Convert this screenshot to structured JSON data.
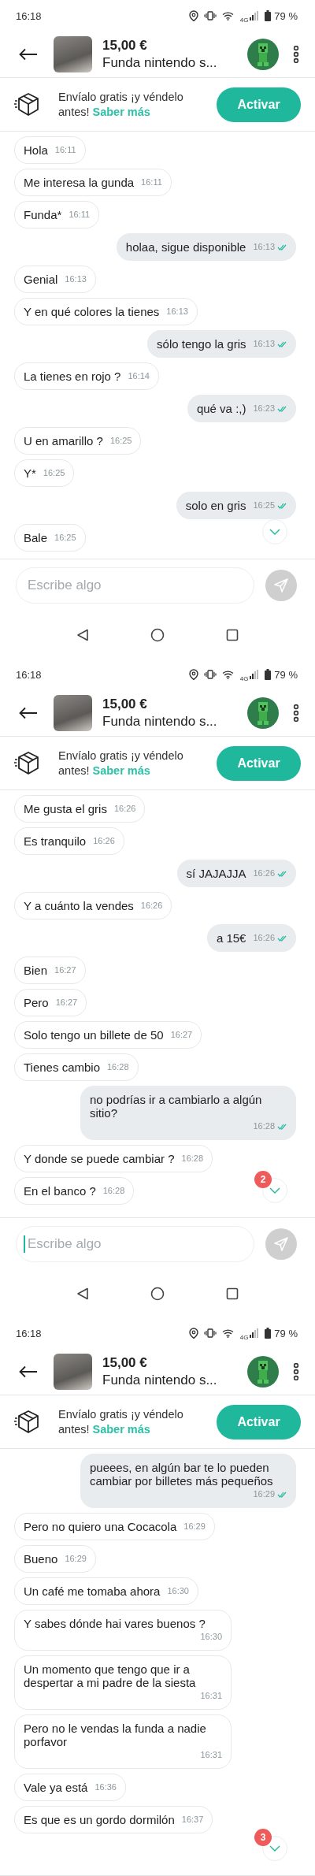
{
  "screens": [
    {
      "status_bar": {
        "time": "16:18",
        "network": "4G",
        "battery": "79 %"
      },
      "header": {
        "price": "15,00 €",
        "title": "Funda nintendo s..."
      },
      "banner": {
        "text": "Envíalo gratis ¡y véndelo antes!",
        "link": "Saber más",
        "button": "Activar"
      },
      "messages": [
        {
          "kind": "received",
          "text": "Hola",
          "time": "16:11"
        },
        {
          "kind": "received",
          "text": "Me interesa la gunda",
          "time": "16:11"
        },
        {
          "kind": "received",
          "text": "Funda*",
          "time": "16:11"
        },
        {
          "kind": "sent",
          "text": "holaa, sigue disponible",
          "time": "16:13",
          "read": true
        },
        {
          "kind": "received",
          "text": "Genial",
          "time": "16:13"
        },
        {
          "kind": "received",
          "text": "Y en qué colores la tienes",
          "time": "16:13"
        },
        {
          "kind": "sent",
          "text": "sólo tengo la gris",
          "time": "16:13",
          "read": true
        },
        {
          "kind": "received",
          "text": "La tienes en rojo ?",
          "time": "16:14"
        },
        {
          "kind": "sent",
          "text": "qué va :,)",
          "time": "16:23",
          "read": true
        },
        {
          "kind": "received",
          "text": "U en amarillo ?",
          "time": "16:25"
        },
        {
          "kind": "received",
          "text": "Y*",
          "time": "16:25"
        },
        {
          "kind": "sent",
          "text": "solo en gris",
          "time": "16:25",
          "read": true
        },
        {
          "kind": "received",
          "text": "Bale",
          "time": "16:25"
        }
      ],
      "scroll_button": true,
      "composer": {
        "placeholder": "Escribe algo",
        "focused": false
      },
      "nav_bar": true
    },
    {
      "status_bar": {
        "time": "16:18",
        "network": "4G",
        "battery": "79 %"
      },
      "header": {
        "price": "15,00 €",
        "title": "Funda nintendo s..."
      },
      "banner": {
        "text": "Envíalo gratis ¡y véndelo antes!",
        "link": "Saber más",
        "button": "Activar"
      },
      "messages": [
        {
          "kind": "received",
          "text": "Me gusta el gris",
          "time": "16:26"
        },
        {
          "kind": "received",
          "text": "Es tranquilo",
          "time": "16:26"
        },
        {
          "kind": "sent",
          "text": "sí JAJAJJA",
          "time": "16:26",
          "read": true
        },
        {
          "kind": "received",
          "text": "Y a cuánto la vendes",
          "time": "16:26"
        },
        {
          "kind": "sent",
          "text": "a 15€",
          "time": "16:26",
          "read": true
        },
        {
          "kind": "received",
          "text": "Bien",
          "time": "16:27"
        },
        {
          "kind": "received",
          "text": "Pero",
          "time": "16:27"
        },
        {
          "kind": "received",
          "text": "Solo tengo un billete de 50",
          "time": "16:27"
        },
        {
          "kind": "received",
          "text": "Tienes cambio",
          "time": "16:28"
        },
        {
          "kind": "sent",
          "text": "no podrías ir a cambiarlo a algún sitio?",
          "time": "16:28",
          "read": true
        },
        {
          "kind": "received",
          "text": "Y donde se puede cambiar ?",
          "time": "16:28"
        },
        {
          "kind": "received",
          "text": "En el banco ?",
          "time": "16:28"
        }
      ],
      "scroll_button": true,
      "scroll_badge": "2",
      "composer": {
        "placeholder": "Escribe algo",
        "focused": true
      },
      "nav_bar": true
    },
    {
      "status_bar": {
        "time": "16:18",
        "network": "4G",
        "battery": "79 %"
      },
      "header": {
        "price": "15,00 €",
        "title": "Funda nintendo s..."
      },
      "banner": {
        "text": "Envíalo gratis ¡y véndelo antes!",
        "link": "Saber más",
        "button": "Activar"
      },
      "messages": [
        {
          "kind": "sent",
          "text": "pueees, en algún bar te lo pueden cambiar por billetes más pequeños",
          "time": "16:29",
          "read": true
        },
        {
          "kind": "received",
          "text": "Pero no quiero una Cocacola",
          "time": "16:29"
        },
        {
          "kind": "received",
          "text": "Bueno",
          "time": "16:29"
        },
        {
          "kind": "received",
          "text": "Un café me tomaba ahora",
          "time": "16:30"
        },
        {
          "kind": "received",
          "text": "Y sabes dónde hai vares buenos ?",
          "time": "16:30"
        },
        {
          "kind": "received",
          "text": "Un momento que tengo que ir a despertar a mi padre de la siesta",
          "time": "16:31"
        },
        {
          "kind": "received",
          "text": "Pero no le vendas la funda a nadie porfavor",
          "time": "16:31"
        },
        {
          "kind": "received",
          "text": "Vale ya está",
          "time": "16:36"
        },
        {
          "kind": "received",
          "text": "Es que es un gordo dormilón",
          "time": "16:37"
        }
      ],
      "scroll_button": true,
      "scroll_badge": "3"
    }
  ]
}
